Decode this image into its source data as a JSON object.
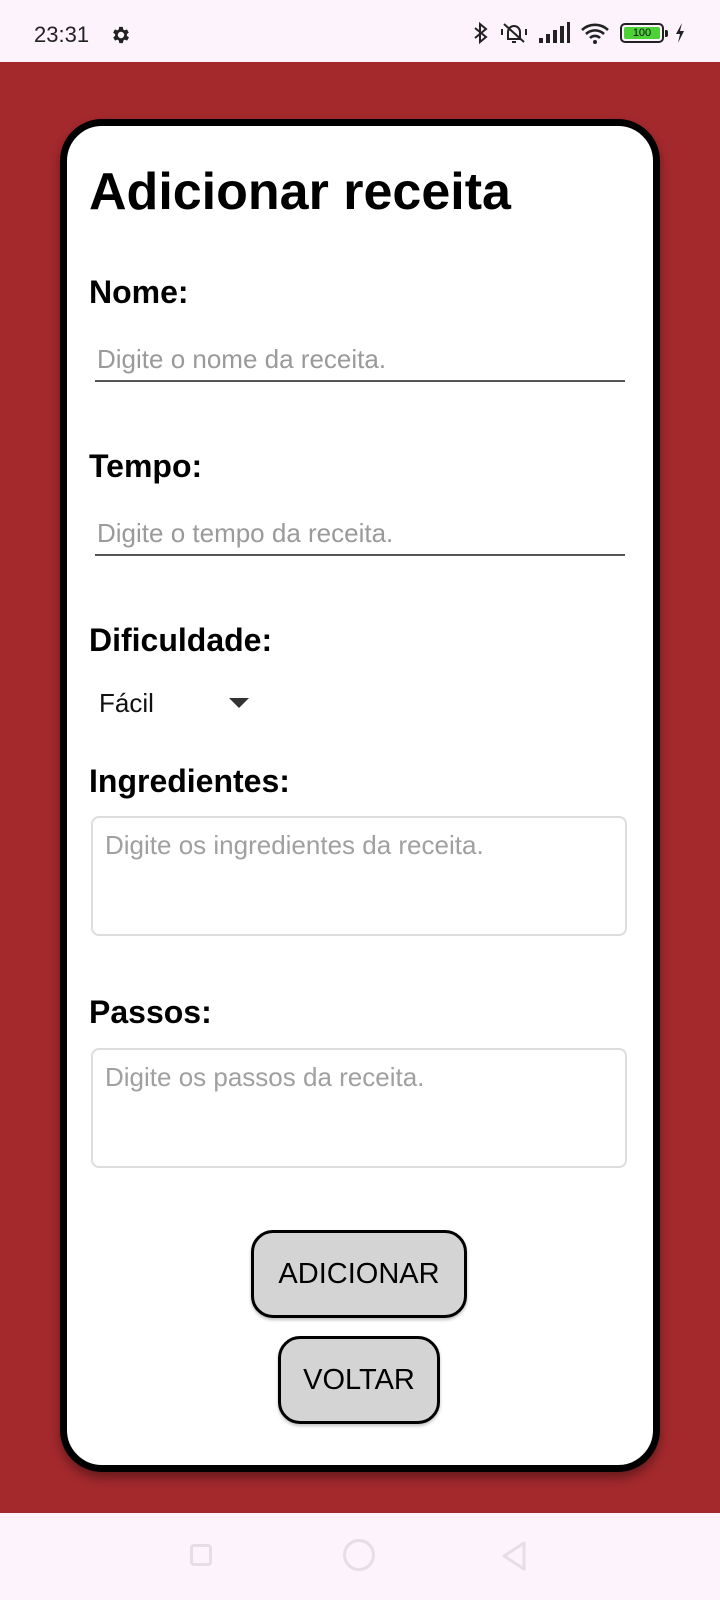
{
  "status_bar": {
    "time": "23:31",
    "icons": [
      "gear-icon",
      "bluetooth-icon",
      "silent-mode-icon",
      "signal-icon",
      "wifi-icon",
      "battery-icon",
      "charging-icon"
    ],
    "battery_level": "100"
  },
  "form": {
    "title": "Adicionar receita",
    "nome": {
      "label": "Nome:",
      "value": "",
      "placeholder": "Digite o nome da receita."
    },
    "tempo": {
      "label": "Tempo:",
      "value": "",
      "placeholder": "Digite o tempo da receita."
    },
    "dificuldade": {
      "label": "Dificuldade:",
      "selected": "Fácil"
    },
    "ingredientes": {
      "label": "Ingredientes:",
      "value": "",
      "placeholder": "Digite os ingredientes da receita."
    },
    "passos": {
      "label": "Passos:",
      "value": "",
      "placeholder": "Digite os passos da receita."
    },
    "add_button": "ADICIONAR",
    "back_button": "VOLTAR"
  },
  "colors": {
    "background": "#a3292d",
    "card": "#ffffff",
    "button": "#d4d4d4",
    "system_bars": "#fdf3fc"
  },
  "nav_bar": {
    "icons": [
      "recents-icon",
      "home-icon",
      "back-icon"
    ]
  }
}
